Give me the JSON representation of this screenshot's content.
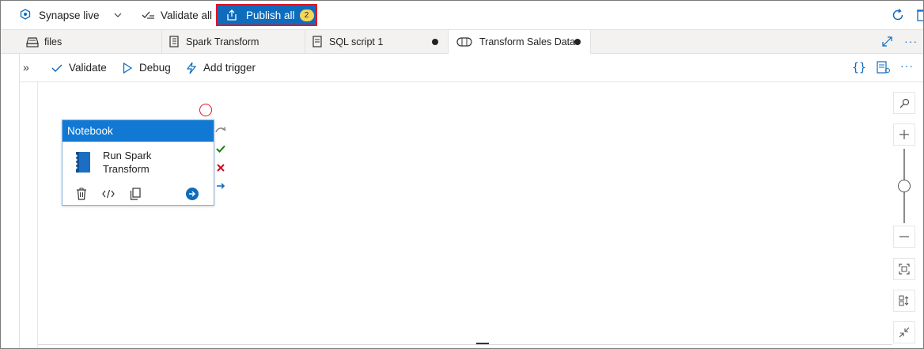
{
  "toolbar": {
    "workspace_label": "Synapse live",
    "validate_all_label": "Validate all",
    "publish_all_label": "Publish all",
    "publish_count": "2"
  },
  "tabs": [
    {
      "label": "files",
      "icon": "files-icon",
      "unsaved": false
    },
    {
      "label": "Spark Transform",
      "icon": "notebook-icon",
      "unsaved": false
    },
    {
      "label": "SQL script 1",
      "icon": "sql-script-icon",
      "unsaved": true
    },
    {
      "label": "Transform Sales Data",
      "icon": "pipeline-icon",
      "unsaved": true,
      "active": true
    }
  ],
  "commands": {
    "validate_label": "Validate",
    "debug_label": "Debug",
    "add_trigger_label": "Add trigger"
  },
  "activity": {
    "type_label": "Notebook",
    "name_line1": "Run Spark",
    "name_line2": "Transform"
  },
  "colors": {
    "accent": "#0f6cbd",
    "activity_header": "#1179d4",
    "highlight_border": "#e81123",
    "badge": "#f5d65a",
    "success": "#107c10",
    "failure": "#c50f1f"
  },
  "zoom_slider_level": 0.5
}
